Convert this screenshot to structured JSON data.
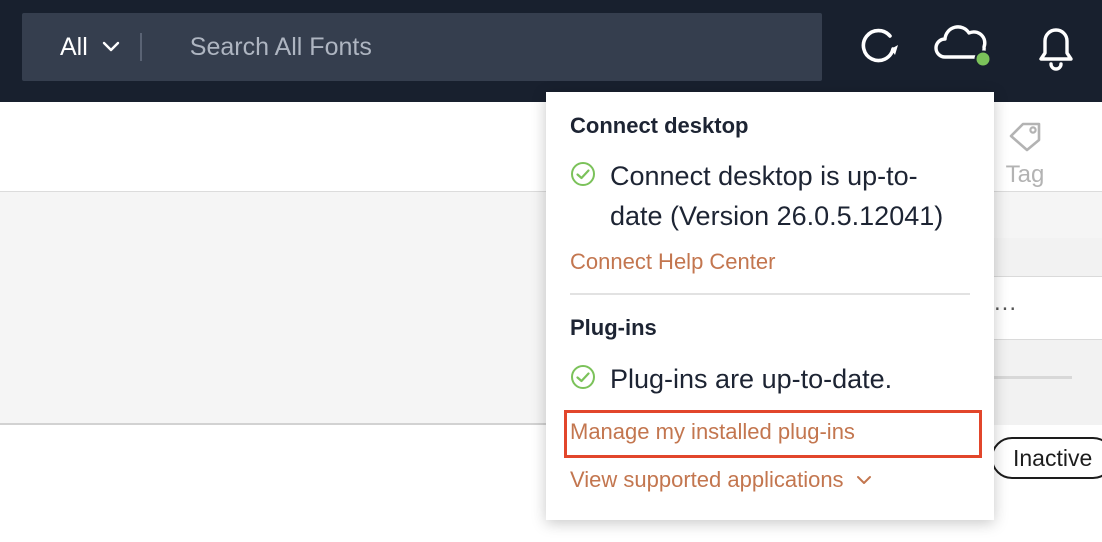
{
  "search": {
    "scope_label": "All",
    "placeholder": "Search All Fonts",
    "value": ""
  },
  "header_icons": {
    "sync": "sync-icon",
    "cloud": "cloud-icon",
    "cloud_status_color": "#7bc25a",
    "bell": "bell-icon"
  },
  "toolbar": {
    "tag_label": "Tag"
  },
  "background": {
    "row_menu_label": "...",
    "status_badge": "Inactive"
  },
  "popover": {
    "connect": {
      "title": "Connect desktop",
      "status_line1": "Connect desktop is up-to-",
      "status_line2": "date (Version 26.0.5.12041)",
      "help_link": "Connect Help Center"
    },
    "plugins": {
      "title": "Plug-ins",
      "status": "Plug-ins are up-to-date.",
      "manage_link": "Manage my installed plug-ins",
      "view_link": "View supported applications"
    }
  },
  "colors": {
    "topbar": "#18202e",
    "search_bg": "#353e4e",
    "link": "#c3764f",
    "check": "#7bc25a",
    "highlight": "#e2462b"
  }
}
